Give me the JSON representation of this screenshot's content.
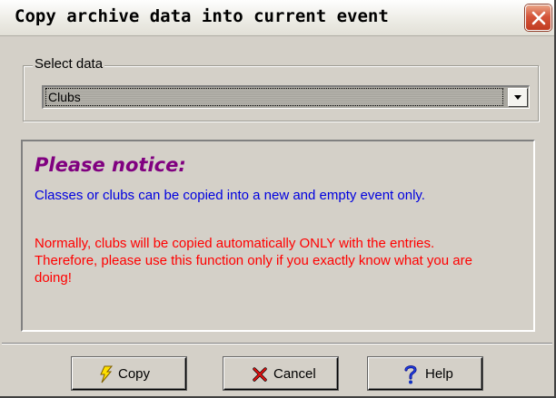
{
  "window": {
    "title": "Copy archive data into current event"
  },
  "select_group": {
    "legend": "Select data",
    "selected_value": "Clubs"
  },
  "notice": {
    "heading": "Please notice:",
    "info_line": "Classes or clubs can be copied into a new and empty event only.",
    "warning_lines": [
      "Normally, clubs will be copied automatically ONLY with the entries.",
      "Therefore, please use this function only if you exactly know what you are",
      "doing!"
    ]
  },
  "buttons": {
    "copy_label": "Copy",
    "cancel_label": "Cancel",
    "help_label": "Help"
  },
  "colors": {
    "heading": "#800080",
    "info": "#0000e0",
    "warning": "#ff0000",
    "close_button": "#d5553a"
  },
  "icons": {
    "copy": "lightning-bolt-icon",
    "cancel": "x-mark-icon",
    "help": "question-mark-icon",
    "close": "close-icon",
    "dropdown": "chevron-down-icon"
  }
}
